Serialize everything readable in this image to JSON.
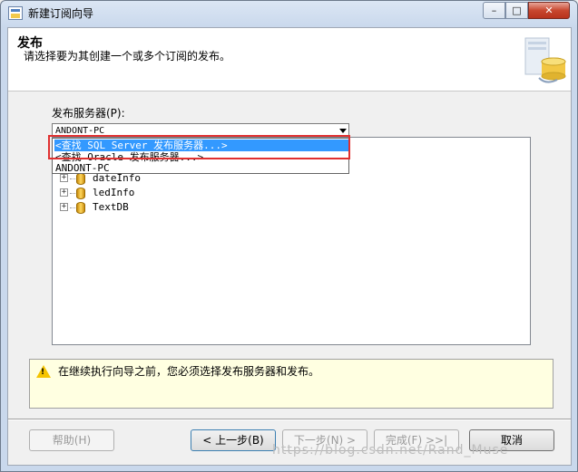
{
  "window": {
    "title": "新建订阅向导",
    "caption_minimize": "–",
    "caption_maximize": "□",
    "caption_close": "✕"
  },
  "header": {
    "title": "发布",
    "subtitle": "请选择要为其创建一个或多个订阅的发布。"
  },
  "publisher": {
    "label": "发布服务器(P):",
    "selected": "ANDONT-PC",
    "options": [
      "<查找 SQL Server 发布服务器...>",
      "<查找 Oracle 发布服务器...>",
      "ANDONT-PC"
    ]
  },
  "tree": {
    "items": [
      {
        "label": "dateInfo",
        "expander": "+"
      },
      {
        "label": "ledInfo",
        "expander": "+"
      },
      {
        "label": "TextDB",
        "expander": "+"
      }
    ]
  },
  "message": {
    "icon": "warning-icon",
    "mark": "!",
    "text": "在继续执行向导之前，您必须选择发布服务器和发布。"
  },
  "buttons": {
    "help": "帮助(H)",
    "back": "< 上一步(B)",
    "next": "下一步(N) >",
    "finish": "完成(F) >>|",
    "cancel": "取消"
  },
  "watermark": "https://blog.csdn.net/Rand_Muse",
  "colors": {
    "selection": "#3399ff",
    "highlight_border": "#e03030",
    "message_bg": "#ffffe1"
  }
}
